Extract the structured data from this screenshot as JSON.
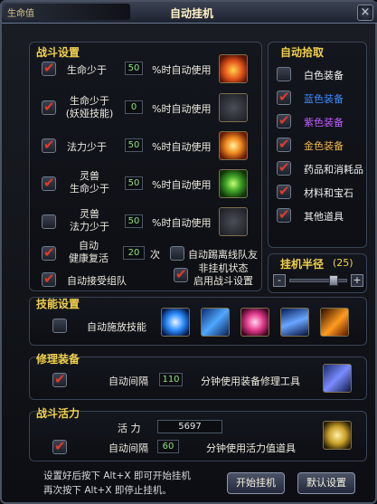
{
  "window": {
    "title": "自动挂机",
    "corner_text": "生命值",
    "close": "×"
  },
  "battle": {
    "title": "战斗设置",
    "rows": [
      {
        "label": "生命少于",
        "value": "50",
        "suffix": "%时自动使用",
        "checked": true
      },
      {
        "label": "生命少于\n(妖娅技能)",
        "value": "0",
        "suffix": "%时自动使用",
        "checked": true
      },
      {
        "label": "法力少于",
        "value": "50",
        "suffix": "%时自动使用",
        "checked": true
      },
      {
        "label": "灵兽\n生命少于",
        "value": "50",
        "suffix": "%时自动使用",
        "checked": true
      },
      {
        "label": "灵兽\n法力少于",
        "value": "50",
        "suffix": "%时自动使用",
        "checked": false
      }
    ],
    "revive": {
      "label": "自动\n健康复活",
      "value": "20",
      "suffix": "次",
      "checked": true
    },
    "leave_team": {
      "label": "自动踢离线队友",
      "checked": false
    },
    "accept_team": {
      "label": "自动接受组队",
      "checked": true
    },
    "offline_mode": {
      "label": "非挂机状态\n启用战斗设置",
      "checked": true
    }
  },
  "pickup": {
    "title": "自动拾取",
    "items": [
      {
        "label": "白色装备",
        "checked": false,
        "color": "#f0f0f0"
      },
      {
        "label": "蓝色装备",
        "checked": true,
        "color": "#3d8cff"
      },
      {
        "label": "紫色装备",
        "checked": true,
        "color": "#c05cff"
      },
      {
        "label": "金色装备",
        "checked": true,
        "color": "#f0b64a"
      },
      {
        "label": "药品和消耗品",
        "checked": true,
        "color": "#f0f0f0"
      },
      {
        "label": "材料和宝石",
        "checked": true,
        "color": "#f0f0f0"
      },
      {
        "label": "其他道具",
        "checked": true,
        "color": "#f0f0f0"
      }
    ]
  },
  "radius": {
    "title": "挂机半径",
    "value": "(25)",
    "minus": "-",
    "plus": "+",
    "level": 0.75
  },
  "skills": {
    "title": "技能设置",
    "label": "自动施放技能",
    "checked": false
  },
  "repair": {
    "title": "修理装备",
    "label": "自动间隔",
    "value": "110",
    "suffix": "分钟使用装备修理工具",
    "checked": true
  },
  "vitality": {
    "title": "战斗活力",
    "vit_label": "活  力",
    "vit_value": "5697",
    "label": "自动间隔",
    "value": "60",
    "suffix": "分钟使用活力值道具",
    "checked": true
  },
  "footer": {
    "line1": "设置好后按下 Alt+X 即可开始挂机",
    "line2": "再次按下 Alt+X 即停止挂机。",
    "start": "开始挂机",
    "default": "默认设置"
  }
}
